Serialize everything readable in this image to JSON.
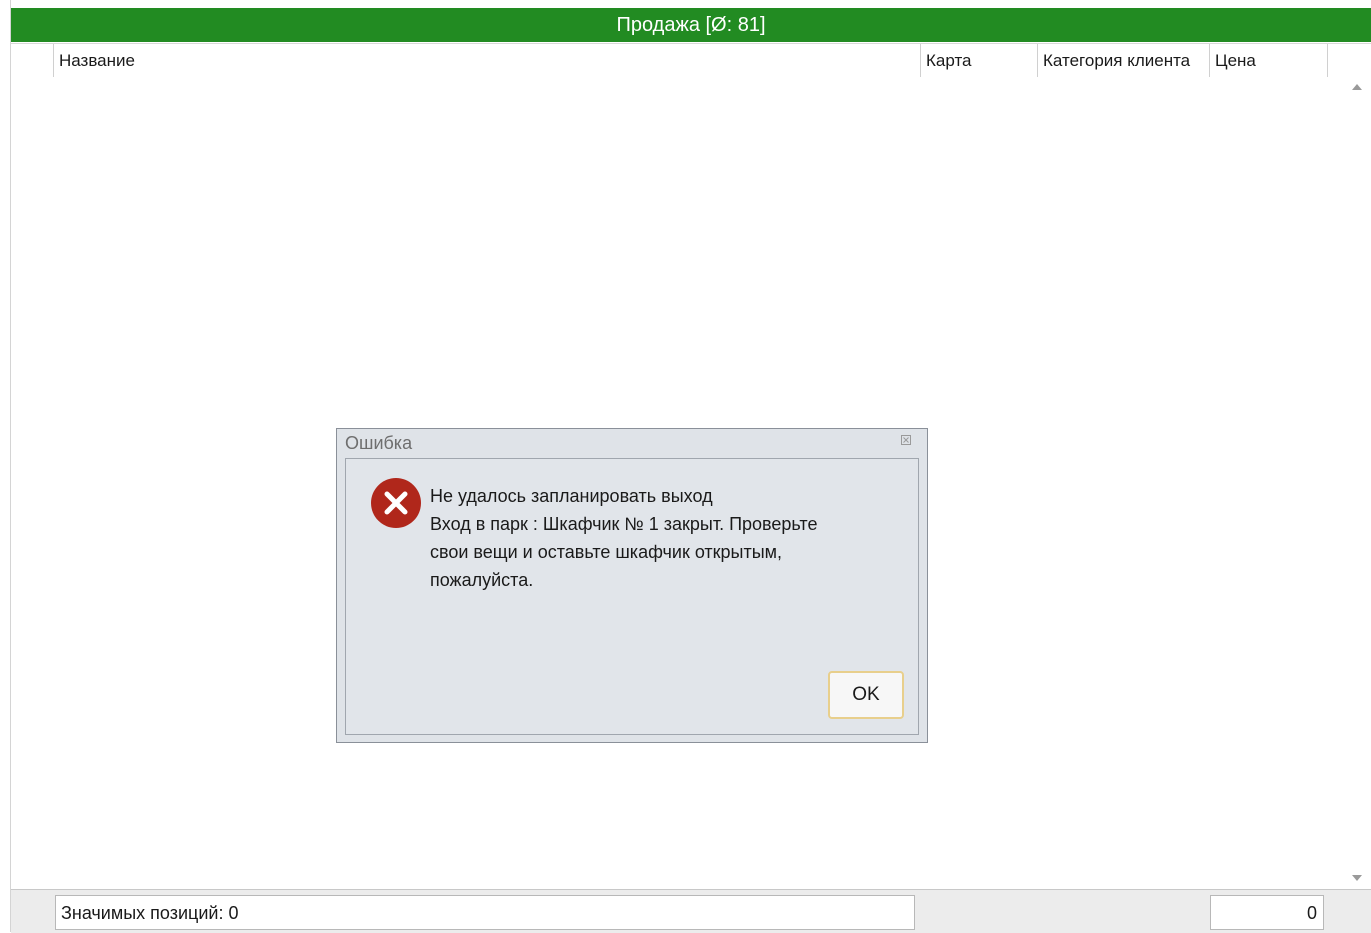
{
  "window": {
    "title": "Продажа [Ø: 81]",
    "accent_color": "#228b22"
  },
  "grid": {
    "columns": [
      {
        "key": "select",
        "label": ""
      },
      {
        "key": "name",
        "label": "Название"
      },
      {
        "key": "card",
        "label": "Карта"
      },
      {
        "key": "category",
        "label": "Категория клиента"
      },
      {
        "key": "price",
        "label": "Цена"
      },
      {
        "key": "extra",
        "label": ""
      }
    ],
    "rows": []
  },
  "footer": {
    "count_text": "Значимых позиций: 0",
    "total": "0"
  },
  "dialog": {
    "title": "Ошибка",
    "close_icon": "close-icon",
    "icon": "error-icon",
    "icon_color": "#b0271b",
    "message_lines": [
      "Не удалось запланировать выход",
      "Вход в парк : Шкафчик № 1  закрыт. Проверьте",
      "свои вещи и оставьте шкафчик открытым,",
      "пожалуйста."
    ],
    "ok_label": "OK"
  }
}
